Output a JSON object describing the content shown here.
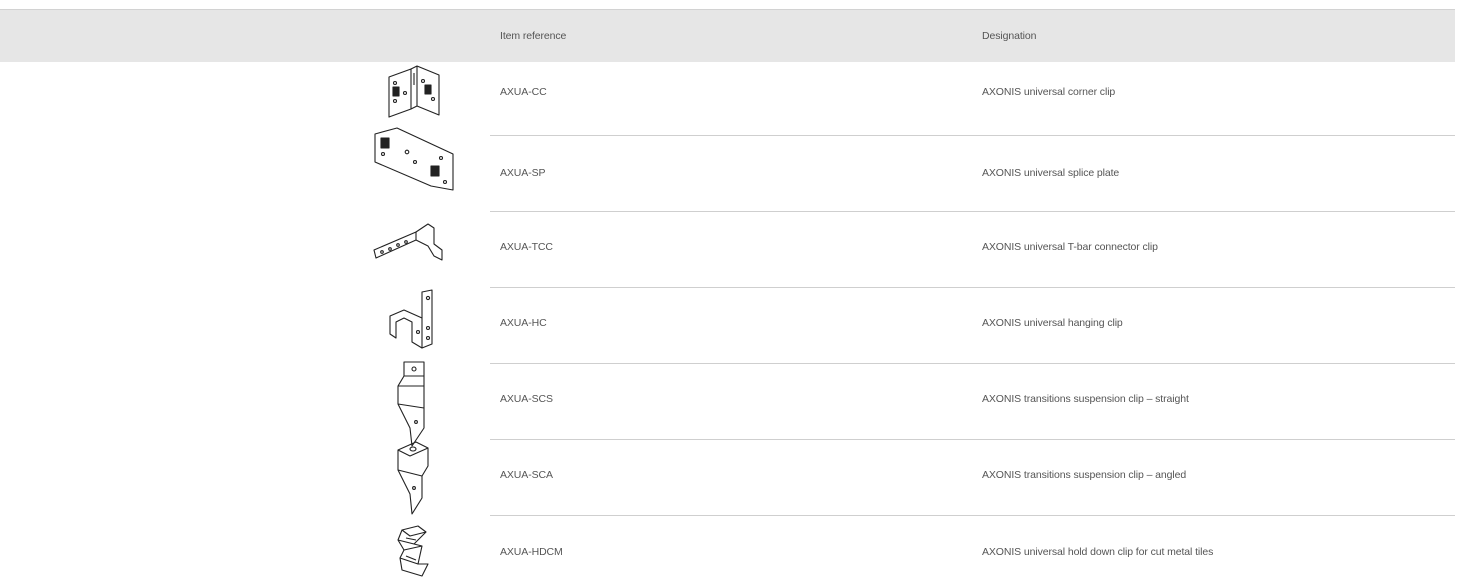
{
  "table": {
    "headers": {
      "item_reference": "Item reference",
      "designation": "Designation"
    },
    "rows": [
      {
        "item_reference": "AXUA-CC",
        "designation": "AXONIS universal corner clip",
        "icon": "corner-clip-icon"
      },
      {
        "item_reference": "AXUA-SP",
        "designation": "AXONIS universal splice plate",
        "icon": "splice-plate-icon"
      },
      {
        "item_reference": "AXUA-TCC",
        "designation": "AXONIS universal T-bar connector clip",
        "icon": "tbar-connector-clip-icon"
      },
      {
        "item_reference": "AXUA-HC",
        "designation": "AXONIS universal hanging clip",
        "icon": "hanging-clip-icon"
      },
      {
        "item_reference": "AXUA-SCS",
        "designation": "AXONIS transitions suspension clip – straight",
        "icon": "suspension-clip-straight-icon"
      },
      {
        "item_reference": "AXUA-SCA",
        "designation": "AXONIS transitions suspension clip – angled",
        "icon": "suspension-clip-angled-icon"
      },
      {
        "item_reference": "AXUA-HDCM",
        "designation": "AXONIS universal hold down clip for cut metal tiles",
        "icon": "hold-down-clip-icon"
      }
    ]
  }
}
